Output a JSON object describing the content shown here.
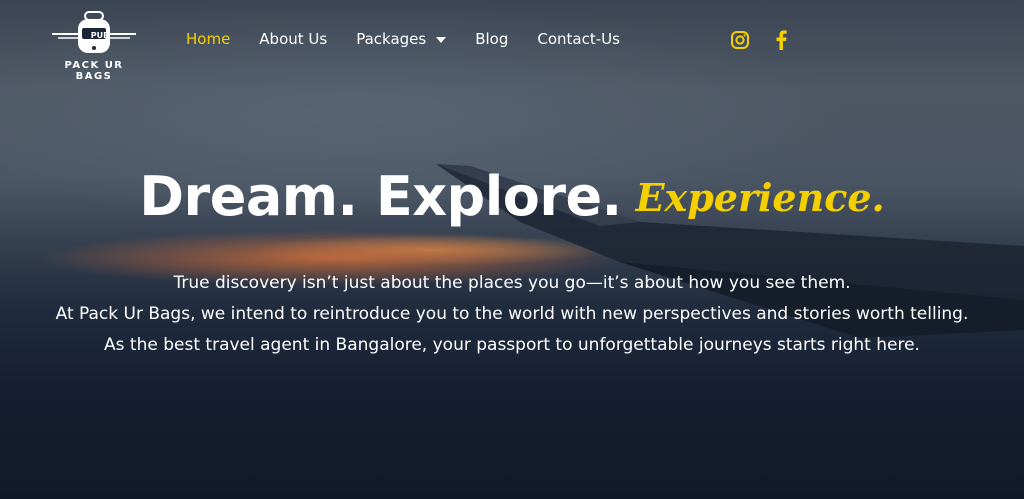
{
  "brand": {
    "name": "PACK UR BAGS",
    "badge": "PUB"
  },
  "nav": {
    "items": [
      {
        "label": "Home",
        "active": true
      },
      {
        "label": "About Us"
      },
      {
        "label": "Packages",
        "dropdown": true
      },
      {
        "label": "Blog"
      },
      {
        "label": "Contact-Us"
      }
    ]
  },
  "social": [
    {
      "icon": "instagram-icon",
      "color": "#f5d000"
    },
    {
      "icon": "facebook-icon",
      "color": "#f5d000"
    }
  ],
  "hero": {
    "headline": "Dream. Explore.",
    "headline_accent": "Experience.",
    "lines": [
      "True discovery isn’t just about the places you go—it’s about how you see them.",
      "At Pack Ur Bags, we intend to reintroduce you to the world with new perspectives and stories worth telling.",
      "As the best travel agent in Bangalore, your passport to unforgettable journeys starts right here."
    ]
  },
  "colors": {
    "accent": "#f5d000",
    "text": "#ffffff"
  }
}
